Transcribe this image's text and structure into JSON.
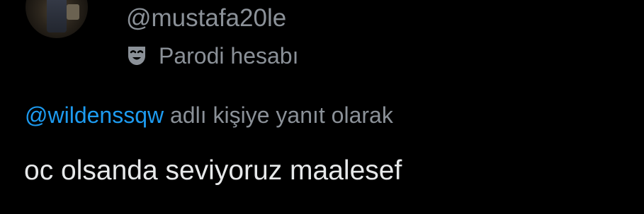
{
  "profile": {
    "handle": "@mustafa20le",
    "parody_label": "Parodi hesabı",
    "parody_icon": "theater-mask-icon"
  },
  "reply": {
    "mention": "@wildenssqw",
    "suffix": " adlı kişiye yanıt olarak"
  },
  "tweet": {
    "text": "oc olsanda seviyoruz maalesef"
  },
  "colors": {
    "background": "#000000",
    "muted_text": "#8b9198",
    "primary_text": "#e7e9ea",
    "link": "#1d9bf0"
  }
}
